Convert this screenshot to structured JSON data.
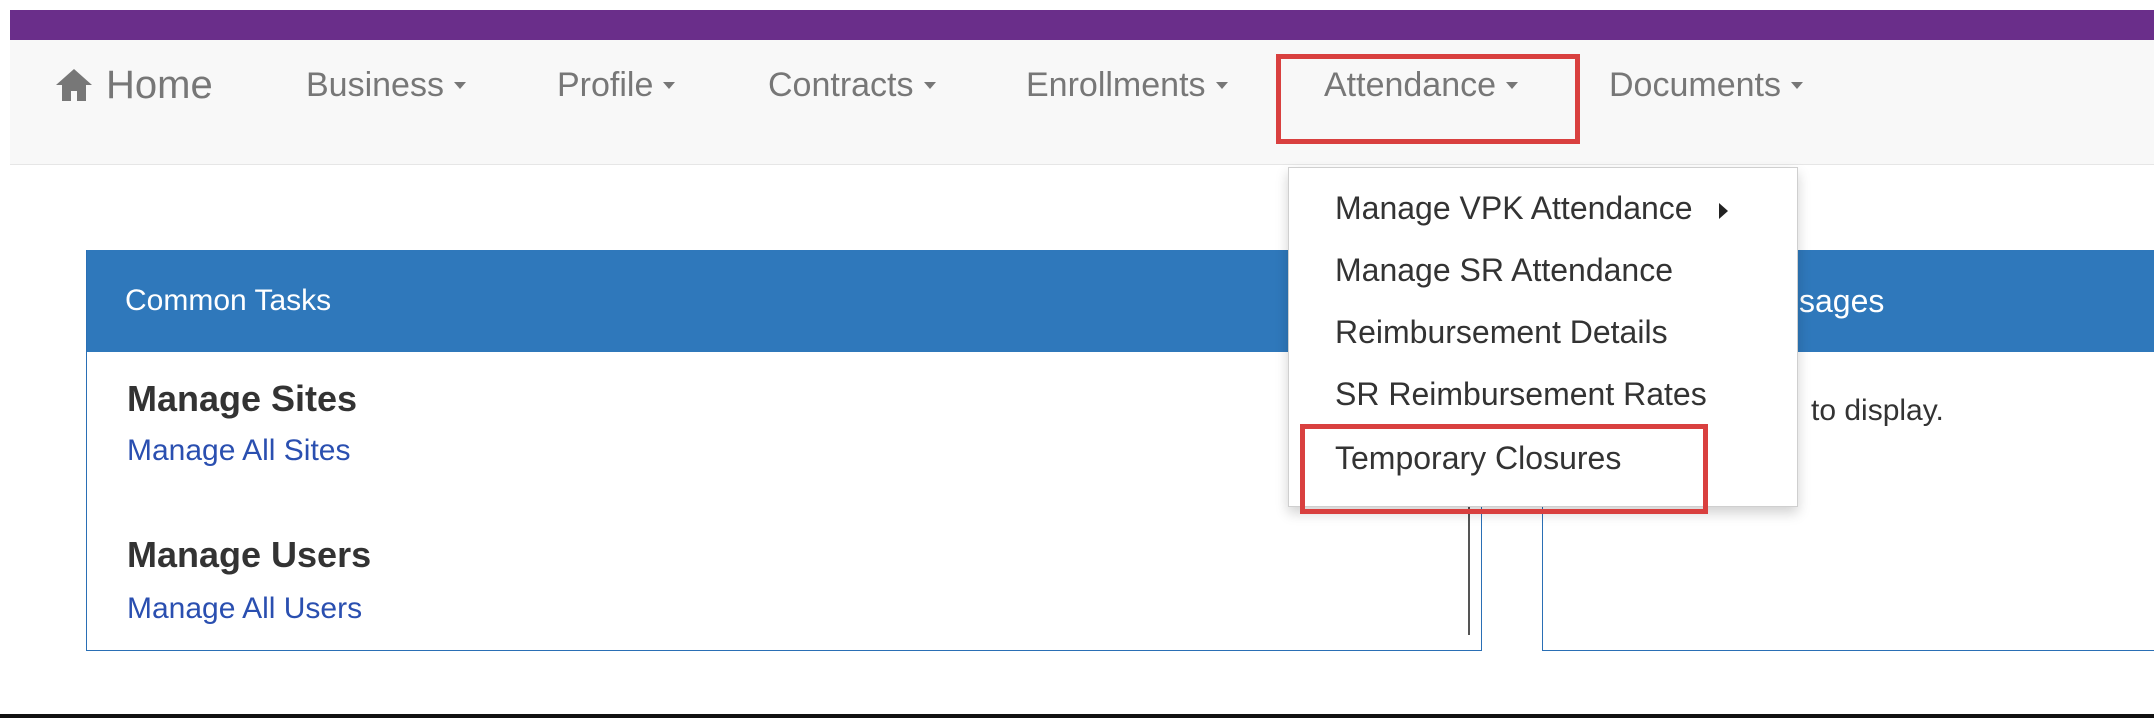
{
  "nav": {
    "home": "Home",
    "items": [
      {
        "label": "Business"
      },
      {
        "label": "Profile"
      },
      {
        "label": "Contracts"
      },
      {
        "label": "Enrollments"
      },
      {
        "label": "Attendance"
      },
      {
        "label": "Documents"
      }
    ]
  },
  "attendance_menu": {
    "items": [
      {
        "label": "Manage VPK Attendance"
      },
      {
        "label": "Manage SR Attendance"
      },
      {
        "label": "Reimbursement Details"
      },
      {
        "label": "SR Reimbursement Rates"
      },
      {
        "label": "Temporary Closures"
      }
    ]
  },
  "common_tasks": {
    "title": "Common Tasks",
    "sections": [
      {
        "title": "Manage Sites",
        "link": "Manage All Sites"
      },
      {
        "title": "Manage Users",
        "link": "Manage All Users"
      }
    ]
  },
  "messages": {
    "title_fragment": "ssages",
    "body_fragment": "to display."
  },
  "colors": {
    "brand_purple": "#6a2e8a",
    "panel_blue": "#2f78bb",
    "highlight_red": "#d9403f"
  }
}
